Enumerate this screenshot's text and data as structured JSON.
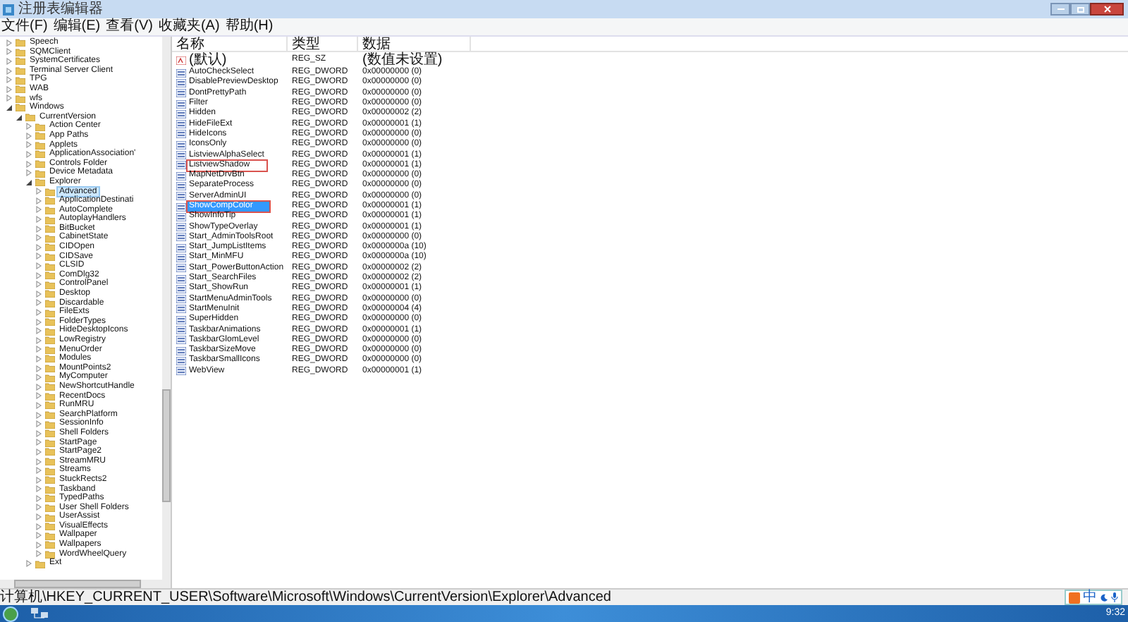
{
  "window": {
    "title": "注册表编辑器"
  },
  "menu": [
    "文件(F)",
    "编辑(E)",
    "查看(V)",
    "收藏夹(A)",
    "帮助(H)"
  ],
  "tree": [
    {
      "label": "Speech",
      "expanded": false,
      "selected": false
    },
    {
      "label": "SQMClient",
      "expanded": false,
      "selected": false
    },
    {
      "label": "SystemCertificates",
      "expanded": false,
      "selected": false
    },
    {
      "label": "Terminal Server Client",
      "expanded": false,
      "selected": false
    },
    {
      "label": "TPG",
      "expanded": false,
      "selected": false
    },
    {
      "label": "WAB",
      "expanded": false,
      "selected": false
    },
    {
      "label": "wfs",
      "expanded": false,
      "selected": false
    },
    {
      "label": "Windows",
      "expanded": true,
      "selected": false,
      "children": [
        {
          "label": "CurrentVersion",
          "expanded": true,
          "selected": false,
          "children": [
            {
              "label": "Action Center",
              "expanded": false,
              "selected": false
            },
            {
              "label": "App Paths",
              "expanded": false,
              "selected": false
            },
            {
              "label": "Applets",
              "expanded": false,
              "selected": false
            },
            {
              "label": "ApplicationAssociation'",
              "expanded": false,
              "selected": false
            },
            {
              "label": "Controls Folder",
              "expanded": false,
              "selected": false
            },
            {
              "label": "Device Metadata",
              "expanded": false,
              "selected": false
            },
            {
              "label": "Explorer",
              "expanded": true,
              "selected": false,
              "children": [
                {
                  "label": "Advanced",
                  "expanded": false,
                  "selected": true
                },
                {
                  "label": "ApplicationDestinati",
                  "expanded": false,
                  "selected": false
                },
                {
                  "label": "AutoComplete",
                  "expanded": false,
                  "selected": false
                },
                {
                  "label": "AutoplayHandlers",
                  "expanded": false,
                  "selected": false
                },
                {
                  "label": "BitBucket",
                  "expanded": false,
                  "selected": false
                },
                {
                  "label": "CabinetState",
                  "expanded": false,
                  "selected": false
                },
                {
                  "label": "CIDOpen",
                  "expanded": false,
                  "selected": false
                },
                {
                  "label": "CIDSave",
                  "expanded": false,
                  "selected": false
                },
                {
                  "label": "CLSID",
                  "expanded": false,
                  "selected": false
                },
                {
                  "label": "ComDlg32",
                  "expanded": false,
                  "selected": false
                },
                {
                  "label": "ControlPanel",
                  "expanded": false,
                  "selected": false
                },
                {
                  "label": "Desktop",
                  "expanded": false,
                  "selected": false
                },
                {
                  "label": "Discardable",
                  "expanded": false,
                  "selected": false
                },
                {
                  "label": "FileExts",
                  "expanded": false,
                  "selected": false
                },
                {
                  "label": "FolderTypes",
                  "expanded": false,
                  "selected": false
                },
                {
                  "label": "HideDesktopIcons",
                  "expanded": false,
                  "selected": false
                },
                {
                  "label": "LowRegistry",
                  "expanded": false,
                  "selected": false
                },
                {
                  "label": "MenuOrder",
                  "expanded": false,
                  "selected": false
                },
                {
                  "label": "Modules",
                  "expanded": false,
                  "selected": false
                },
                {
                  "label": "MountPoints2",
                  "expanded": false,
                  "selected": false
                },
                {
                  "label": "MyComputer",
                  "expanded": false,
                  "selected": false
                },
                {
                  "label": "NewShortcutHandle",
                  "expanded": false,
                  "selected": false
                },
                {
                  "label": "RecentDocs",
                  "expanded": false,
                  "selected": false
                },
                {
                  "label": "RunMRU",
                  "expanded": false,
                  "selected": false
                },
                {
                  "label": "SearchPlatform",
                  "expanded": false,
                  "selected": false
                },
                {
                  "label": "SessionInfo",
                  "expanded": false,
                  "selected": false
                },
                {
                  "label": "Shell Folders",
                  "expanded": false,
                  "selected": false
                },
                {
                  "label": "StartPage",
                  "expanded": false,
                  "selected": false
                },
                {
                  "label": "StartPage2",
                  "expanded": false,
                  "selected": false
                },
                {
                  "label": "StreamMRU",
                  "expanded": false,
                  "selected": false
                },
                {
                  "label": "Streams",
                  "expanded": false,
                  "selected": false
                },
                {
                  "label": "StuckRects2",
                  "expanded": false,
                  "selected": false
                },
                {
                  "label": "Taskband",
                  "expanded": false,
                  "selected": false
                },
                {
                  "label": "TypedPaths",
                  "expanded": false,
                  "selected": false
                },
                {
                  "label": "User Shell Folders",
                  "expanded": false,
                  "selected": false
                },
                {
                  "label": "UserAssist",
                  "expanded": false,
                  "selected": false
                },
                {
                  "label": "VisualEffects",
                  "expanded": false,
                  "selected": false
                },
                {
                  "label": "Wallpaper",
                  "expanded": false,
                  "selected": false
                },
                {
                  "label": "Wallpapers",
                  "expanded": false,
                  "selected": false
                },
                {
                  "label": "WordWheelQuery",
                  "expanded": false,
                  "selected": false
                }
              ]
            },
            {
              "label": "Ext",
              "expanded": false,
              "selected": false
            }
          ]
        }
      ]
    }
  ],
  "table": {
    "columns": [
      "名称",
      "类型",
      "数据"
    ],
    "rows": [
      {
        "kind": "default",
        "name": "(默认)",
        "type": "REG_SZ",
        "data": "(数值未设置)",
        "selected": false,
        "highlighted": false
      },
      {
        "kind": "dword",
        "name": "AutoCheckSelect",
        "type": "REG_DWORD",
        "data": "0x00000000 (0)",
        "selected": false,
        "highlighted": false
      },
      {
        "kind": "dword",
        "name": "DisablePreviewDesktop",
        "type": "REG_DWORD",
        "data": "0x00000000 (0)",
        "selected": false,
        "highlighted": false
      },
      {
        "kind": "dword",
        "name": "DontPrettyPath",
        "type": "REG_DWORD",
        "data": "0x00000000 (0)",
        "selected": false,
        "highlighted": false
      },
      {
        "kind": "dword",
        "name": "Filter",
        "type": "REG_DWORD",
        "data": "0x00000000 (0)",
        "selected": false,
        "highlighted": false
      },
      {
        "kind": "dword",
        "name": "Hidden",
        "type": "REG_DWORD",
        "data": "0x00000002 (2)",
        "selected": false,
        "highlighted": false
      },
      {
        "kind": "dword",
        "name": "HideFileExt",
        "type": "REG_DWORD",
        "data": "0x00000001 (1)",
        "selected": false,
        "highlighted": false
      },
      {
        "kind": "dword",
        "name": "HideIcons",
        "type": "REG_DWORD",
        "data": "0x00000000 (0)",
        "selected": false,
        "highlighted": false
      },
      {
        "kind": "dword",
        "name": "IconsOnly",
        "type": "REG_DWORD",
        "data": "0x00000000 (0)",
        "selected": false,
        "highlighted": false
      },
      {
        "kind": "dword",
        "name": "ListviewAlphaSelect",
        "type": "REG_DWORD",
        "data": "0x00000001 (1)",
        "selected": false,
        "highlighted": false
      },
      {
        "kind": "dword",
        "name": "ListviewShadow",
        "type": "REG_DWORD",
        "data": "0x00000001 (1)",
        "selected": false,
        "highlighted": true
      },
      {
        "kind": "dword",
        "name": "MapNetDrvBtn",
        "type": "REG_DWORD",
        "data": "0x00000000 (0)",
        "selected": false,
        "highlighted": false
      },
      {
        "kind": "dword",
        "name": "SeparateProcess",
        "type": "REG_DWORD",
        "data": "0x00000000 (0)",
        "selected": false,
        "highlighted": false
      },
      {
        "kind": "dword",
        "name": "ServerAdminUI",
        "type": "REG_DWORD",
        "data": "0x00000000 (0)",
        "selected": false,
        "highlighted": false
      },
      {
        "kind": "dword",
        "name": "ShowCompColor",
        "type": "REG_DWORD",
        "data": "0x00000001 (1)",
        "selected": true,
        "highlighted": true
      },
      {
        "kind": "dword",
        "name": "ShowInfoTip",
        "type": "REG_DWORD",
        "data": "0x00000001 (1)",
        "selected": false,
        "highlighted": false
      },
      {
        "kind": "dword",
        "name": "ShowTypeOverlay",
        "type": "REG_DWORD",
        "data": "0x00000001 (1)",
        "selected": false,
        "highlighted": false
      },
      {
        "kind": "dword",
        "name": "Start_AdminToolsRoot",
        "type": "REG_DWORD",
        "data": "0x00000000 (0)",
        "selected": false,
        "highlighted": false
      },
      {
        "kind": "dword",
        "name": "Start_JumpListItems",
        "type": "REG_DWORD",
        "data": "0x0000000a (10)",
        "selected": false,
        "highlighted": false
      },
      {
        "kind": "dword",
        "name": "Start_MinMFU",
        "type": "REG_DWORD",
        "data": "0x0000000a (10)",
        "selected": false,
        "highlighted": false
      },
      {
        "kind": "dword",
        "name": "Start_PowerButtonAction",
        "type": "REG_DWORD",
        "data": "0x00000002 (2)",
        "selected": false,
        "highlighted": false
      },
      {
        "kind": "dword",
        "name": "Start_SearchFiles",
        "type": "REG_DWORD",
        "data": "0x00000002 (2)",
        "selected": false,
        "highlighted": false
      },
      {
        "kind": "dword",
        "name": "Start_ShowRun",
        "type": "REG_DWORD",
        "data": "0x00000001 (1)",
        "selected": false,
        "highlighted": false
      },
      {
        "kind": "dword",
        "name": "StartMenuAdminTools",
        "type": "REG_DWORD",
        "data": "0x00000000 (0)",
        "selected": false,
        "highlighted": false
      },
      {
        "kind": "dword",
        "name": "StartMenuInit",
        "type": "REG_DWORD",
        "data": "0x00000004 (4)",
        "selected": false,
        "highlighted": false
      },
      {
        "kind": "dword",
        "name": "SuperHidden",
        "type": "REG_DWORD",
        "data": "0x00000000 (0)",
        "selected": false,
        "highlighted": false
      },
      {
        "kind": "dword",
        "name": "TaskbarAnimations",
        "type": "REG_DWORD",
        "data": "0x00000001 (1)",
        "selected": false,
        "highlighted": false
      },
      {
        "kind": "dword",
        "name": "TaskbarGlomLevel",
        "type": "REG_DWORD",
        "data": "0x00000000 (0)",
        "selected": false,
        "highlighted": false
      },
      {
        "kind": "dword",
        "name": "TaskbarSizeMove",
        "type": "REG_DWORD",
        "data": "0x00000000 (0)",
        "selected": false,
        "highlighted": false
      },
      {
        "kind": "dword",
        "name": "TaskbarSmallIcons",
        "type": "REG_DWORD",
        "data": "0x00000000 (0)",
        "selected": false,
        "highlighted": false
      },
      {
        "kind": "dword",
        "name": "WebView",
        "type": "REG_DWORD",
        "data": "0x00000001 (1)",
        "selected": false,
        "highlighted": false
      }
    ]
  },
  "status_bar": "计算机\\HKEY_CURRENT_USER\\Software\\Microsoft\\Windows\\CurrentVersion\\Explorer\\Advanced",
  "ime_bar": {
    "mode": "中"
  },
  "taskbar": {
    "clock": "9:32"
  }
}
